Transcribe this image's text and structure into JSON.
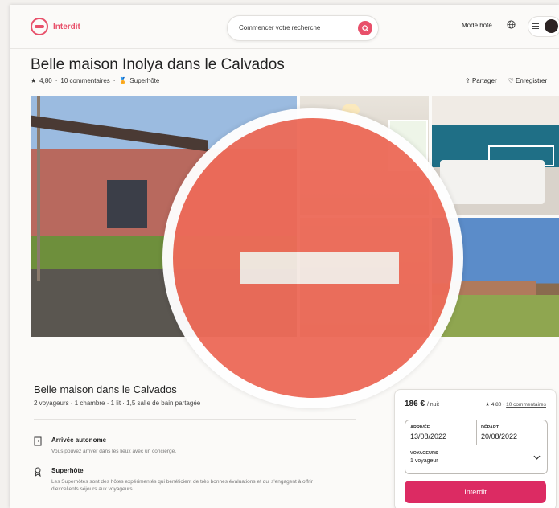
{
  "header": {
    "logo_text": "Interdit",
    "search_placeholder": "Commencer votre recherche",
    "host_mode": "Mode hôte"
  },
  "listing": {
    "title": "Belle maison Inolya dans le Calvados",
    "rating": "4,80",
    "reviews_link": "10 commentaires",
    "superhost": "Superhôte",
    "share": "Partager",
    "save": "Enregistrer"
  },
  "details": {
    "title": "Belle maison dans le Calvados",
    "summary": "2 voyageurs · 1 chambre · 1 lit · 1,5 salle de bain partagée",
    "features": [
      {
        "title": "Arrivée autonome",
        "desc": "Vous pouvez arriver dans les lieux avec un concierge."
      },
      {
        "title": "Superhôte",
        "desc": "Les Superhôtes sont des hôtes expérimentés qui bénéficient de très bonnes évaluations et qui s'engagent à offrir d'excellents séjours aux voyageurs."
      }
    ]
  },
  "booking": {
    "price": "186 €",
    "per_night": "/ nuit",
    "rating": "4,80",
    "reviews": "10 commentaires",
    "arrival_label": "ARRIVÉE",
    "arrival_value": "13/08/2022",
    "departure_label": "DÉPART",
    "departure_value": "20/08/2022",
    "guests_label": "VOYAGEURS",
    "guests_value": "1 voyageur",
    "button": "Interdit"
  },
  "colors": {
    "accent": "#e8506a",
    "button": "#dc2b63",
    "forbidden": "#ed6b59"
  }
}
